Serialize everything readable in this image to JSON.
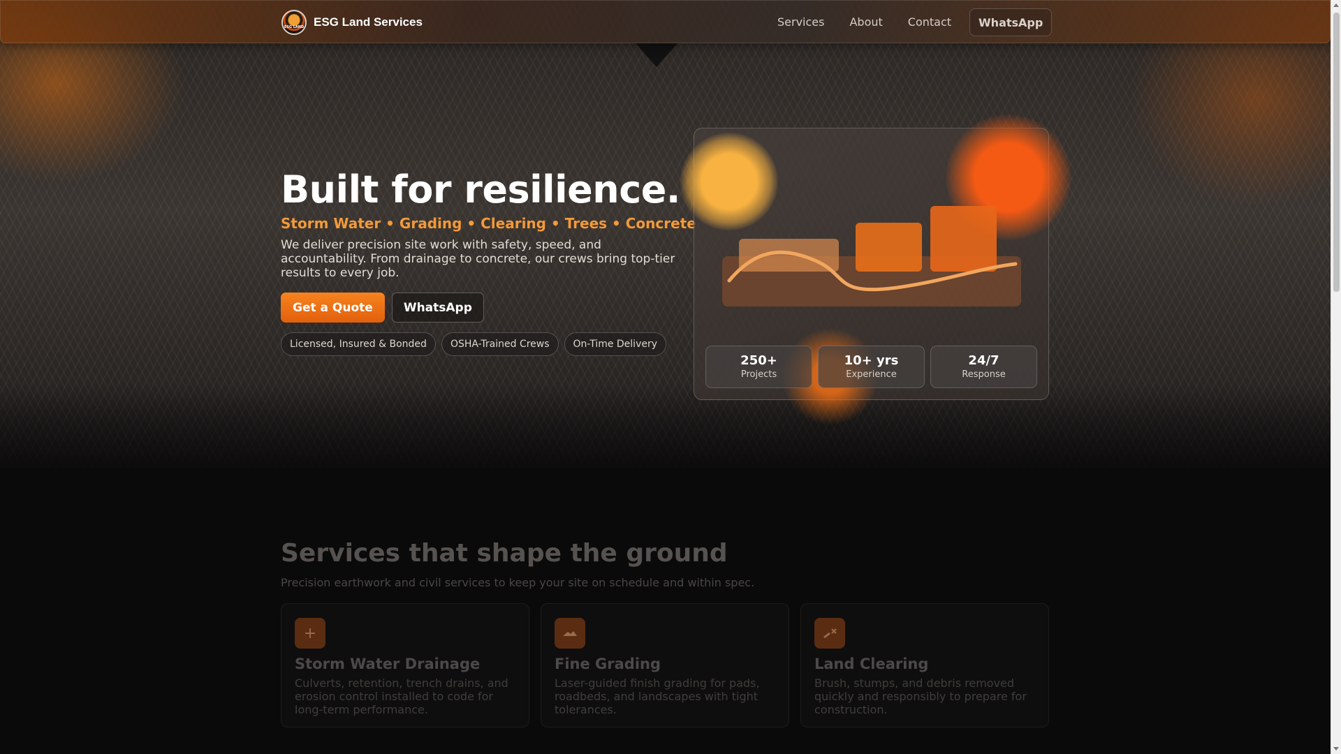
{
  "nav": {
    "brand": "ESG Land Services",
    "logo_text": "ESG LAND",
    "links": [
      "Services",
      "About",
      "Contact"
    ],
    "whatsapp_label": "WhatsApp"
  },
  "hero": {
    "title": "Built for resilience.",
    "tagline": "Storm Water • Grading • Clearing • Trees • Concrete",
    "description": "We deliver precision site work with safety, speed, and accountability. From drainage to concrete, our crews bring top-tier results to every job.",
    "quote_button": "Get a Quote",
    "whatsapp_button": "WhatsApp",
    "badges": [
      "Licensed, Insured & Bonded",
      "OSHA-Trained Crews",
      "On-Time Delivery"
    ]
  },
  "stats": [
    {
      "value": "250+",
      "label": "Projects"
    },
    {
      "value": "10+ yrs",
      "label": "Experience"
    },
    {
      "value": "24/7",
      "label": "Response"
    }
  ],
  "services": {
    "title": "Services that shape the ground",
    "subtitle": "Precision earthwork and civil services to keep your site on schedule and within spec.",
    "items": [
      {
        "icon": "drainage-icon",
        "title": "Storm Water Drainage",
        "description": "Culverts, retention, trench drains, and erosion control installed to code for long-term performance."
      },
      {
        "icon": "grading-icon",
        "title": "Fine Grading",
        "description": "Laser-guided finish grading for pads, roadbeds, and landscapes with tight tolerances."
      },
      {
        "icon": "clearing-icon",
        "title": "Land Clearing",
        "description": "Brush, stumps, and debris removed quickly and responsibly to prepare for construction."
      }
    ]
  },
  "colors": {
    "accent": "#f7831f",
    "tagline": "#f29a3a",
    "glow_yellow": "#f8b241",
    "glow_orange": "#f55a14"
  }
}
